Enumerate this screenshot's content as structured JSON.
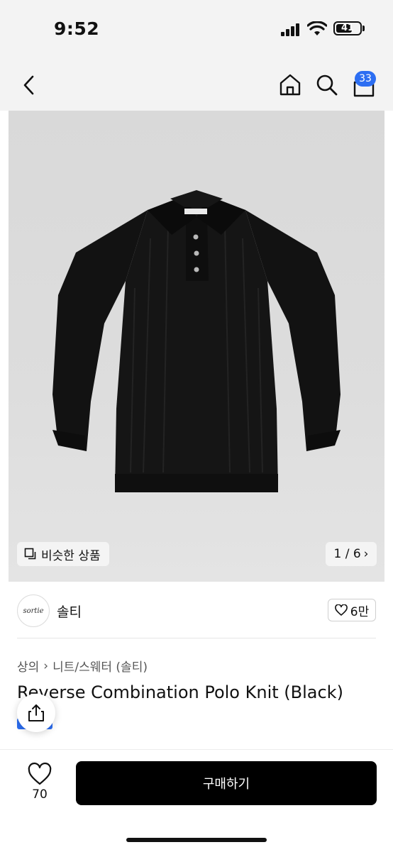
{
  "status_bar": {
    "time": "9:52",
    "battery": "41"
  },
  "nav": {
    "cart_count": "33"
  },
  "gallery": {
    "similar_label": "비슷한 상품",
    "pager": "1 / 6",
    "pager_arrow": "›"
  },
  "brand": {
    "logo_text": "sortie",
    "name": "솔티",
    "likes": "6만"
  },
  "product": {
    "breadcrumb": [
      "상의",
      "니트/스웨터 (솔티)"
    ],
    "breadcrumb_sep": "›",
    "title": "Reverse Combination Polo Knit (Black)"
  },
  "bottom_bar": {
    "like_count": "70",
    "buy_label": "구매하기"
  },
  "colors": {
    "accent": "#2c6ef2",
    "buy_bg": "#000000"
  }
}
